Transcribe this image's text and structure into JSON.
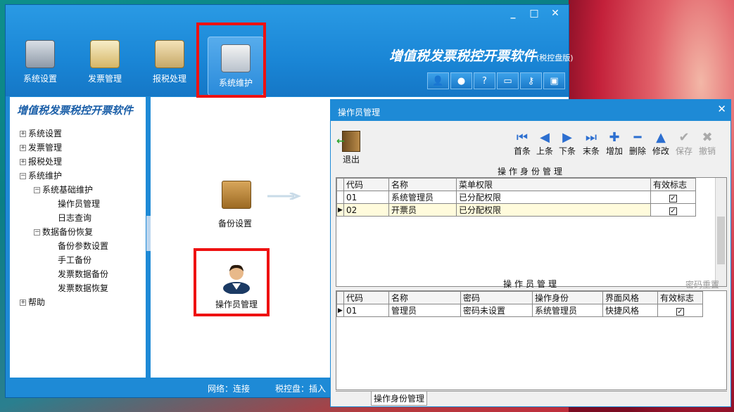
{
  "app": {
    "title": "增值税发票税控开票软件",
    "edition": "(税控盘版)",
    "window_controls": [
      "_",
      "□",
      "✕"
    ]
  },
  "toolbar": {
    "items": [
      "系统设置",
      "发票管理",
      "报税处理",
      "系统维护"
    ],
    "active": "系统维护"
  },
  "tree": {
    "title": "增值税发票税控开票软件",
    "nodes": {
      "n0": "系统设置",
      "n1": "发票管理",
      "n2": "报税处理",
      "n3": "系统维护",
      "n4": "系统基础维护",
      "n5": "操作员管理",
      "n6": "日志查询",
      "n7": "数据备份恢复",
      "n8": "备份参数设置",
      "n9": "手工备份",
      "n10": "发票数据备份",
      "n11": "发票数据恢复",
      "n12": "帮助"
    }
  },
  "content": {
    "backup_label": "备份设置",
    "operator_label": "操作员管理"
  },
  "status": {
    "network": "网络：连接",
    "disk": "税控盘：插入"
  },
  "dialog": {
    "title": "操作员管理",
    "close": "✕",
    "exit_label": "退出",
    "nav": {
      "first": "首条",
      "prev": "上条",
      "next": "下条",
      "last": "末条",
      "add": "增加",
      "delete": "删除",
      "edit": "修改",
      "save": "保存",
      "cancel": "撤销"
    },
    "role_grid_title": "操作身份管理",
    "role_columns": [
      "代码",
      "名称",
      "菜单权限",
      "有效标志"
    ],
    "role_rows": [
      {
        "code": "01",
        "name": "系统管理员",
        "perm": "已分配权限",
        "valid": "✓"
      },
      {
        "code": "02",
        "name": "开票员",
        "perm": "已分配权限",
        "valid": "✓"
      }
    ],
    "operator_grid_title": "操作员管理",
    "password_reset": "密码重置",
    "operator_columns": [
      "代码",
      "名称",
      "密码",
      "操作身份",
      "界面风格",
      "有效标志"
    ],
    "operator_rows": [
      {
        "code": "01",
        "name": "管理员",
        "pwd": "密码未设置",
        "role": "系统管理员",
        "style": "快捷风格",
        "valid": "✓"
      }
    ],
    "tab_label": "操作身份管理"
  }
}
